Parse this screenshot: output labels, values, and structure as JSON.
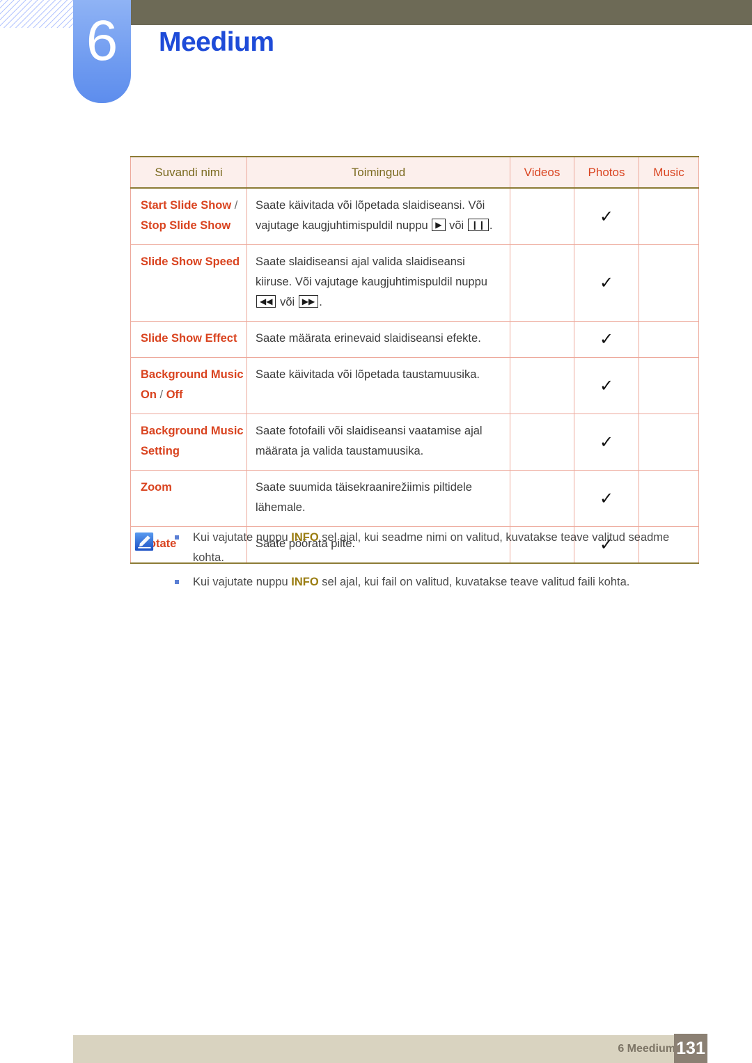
{
  "header": {
    "chapter_number": "6",
    "chapter_title": "Meedium"
  },
  "table": {
    "columns": [
      "Suvandi nimi",
      "Toimingud",
      "Videos",
      "Photos",
      "Music"
    ],
    "rows": [
      {
        "name_parts": [
          "Start Slide Show",
          " / ",
          "Stop Slide Show"
        ],
        "action_line1": "Saate käivitada või lõpetada slaidiseansi. Või",
        "action_line2_pre": "vajutage kaugjuhtimispuldil nuppu",
        "icon1": "play-icon",
        "icon1_glyph": "▶",
        "action_mid": "või",
        "icon2": "pause-icon",
        "icon2_glyph": "❙❙",
        "action_end": ".",
        "videos": "",
        "photos": "✓",
        "music": ""
      },
      {
        "name_parts": [
          "Slide Show Speed",
          "",
          ""
        ],
        "action_line1": "Saate slaidiseansi ajal valida slaidiseansi",
        "action_line2_pre": "kiiruse. Või vajutage kaugjuhtimispuldil nuppu",
        "icon1": "rewind-icon",
        "icon1_glyph": "◀◀",
        "action_mid": "või",
        "icon2": "fast-forward-icon",
        "icon2_glyph": "▶▶",
        "action_end": ".",
        "videos": "",
        "photos": "✓",
        "music": ""
      },
      {
        "name_parts": [
          "Slide Show Effect",
          "",
          ""
        ],
        "action_line1": "Saate määrata erinevaid slaidiseansi efekte.",
        "action_line2_pre": "",
        "icon1": "",
        "icon1_glyph": "",
        "action_mid": "",
        "icon2": "",
        "icon2_glyph": "",
        "action_end": "",
        "videos": "",
        "photos": "✓",
        "music": ""
      },
      {
        "name_parts": [
          "Background Music On",
          " / ",
          "Off"
        ],
        "action_line1": "Saate käivitada või lõpetada taustamuusika.",
        "action_line2_pre": "",
        "icon1": "",
        "icon1_glyph": "",
        "action_mid": "",
        "icon2": "",
        "icon2_glyph": "",
        "action_end": "",
        "videos": "",
        "photos": "✓",
        "music": ""
      },
      {
        "name_parts": [
          "Background Music Setting",
          "",
          ""
        ],
        "action_line1": "Saate fotofaili või slaidiseansi vaatamise ajal",
        "action_line2_pre": "määrata ja valida taustamuusika.",
        "icon1": "",
        "icon1_glyph": "",
        "action_mid": "",
        "icon2": "",
        "icon2_glyph": "",
        "action_end": "",
        "videos": "",
        "photos": "✓",
        "music": ""
      },
      {
        "name_parts": [
          "Zoom",
          "",
          ""
        ],
        "action_line1": "Saate suumida täisekraanirežiimis piltidele",
        "action_line2_pre": "lähemale.",
        "icon1": "",
        "icon1_glyph": "",
        "action_mid": "",
        "icon2": "",
        "icon2_glyph": "",
        "action_end": "",
        "videos": "",
        "photos": "✓",
        "music": ""
      },
      {
        "name_parts": [
          "Rotate",
          "",
          ""
        ],
        "action_line1": "Saate pöörata pilte.",
        "action_line2_pre": "",
        "icon1": "",
        "icon1_glyph": "",
        "action_mid": "",
        "icon2": "",
        "icon2_glyph": "",
        "action_end": "",
        "videos": "",
        "photos": "✓",
        "music": ""
      }
    ]
  },
  "note": {
    "icon": "note-pencil-icon",
    "items": [
      {
        "pre": "Kui vajutate nuppu ",
        "key": "INFO",
        "post": " sel ajal, kui seadme nimi on valitud, kuvatakse teave valitud seadme kohta."
      },
      {
        "pre": "Kui vajutate nuppu ",
        "key": "INFO",
        "post": " sel ajal, kui fail on valitud, kuvatakse teave valitud faili kohta."
      }
    ]
  },
  "footer": {
    "label": "6 Meedium",
    "page": "131"
  },
  "colors": {
    "header_band": "#6d6a56",
    "chapter_tab": "#6f9bf0",
    "chapter_title": "#1e4bd8",
    "table_header_bg": "#fcefec",
    "table_border": "#eda99b",
    "table_rule": "#8c7b35",
    "option_name": "#d9431f",
    "header_label": "#7a6a1f",
    "info_key": "#9a7d12",
    "footer_bar": "#d9d3c0",
    "footer_page_bg": "#8b8073"
  }
}
